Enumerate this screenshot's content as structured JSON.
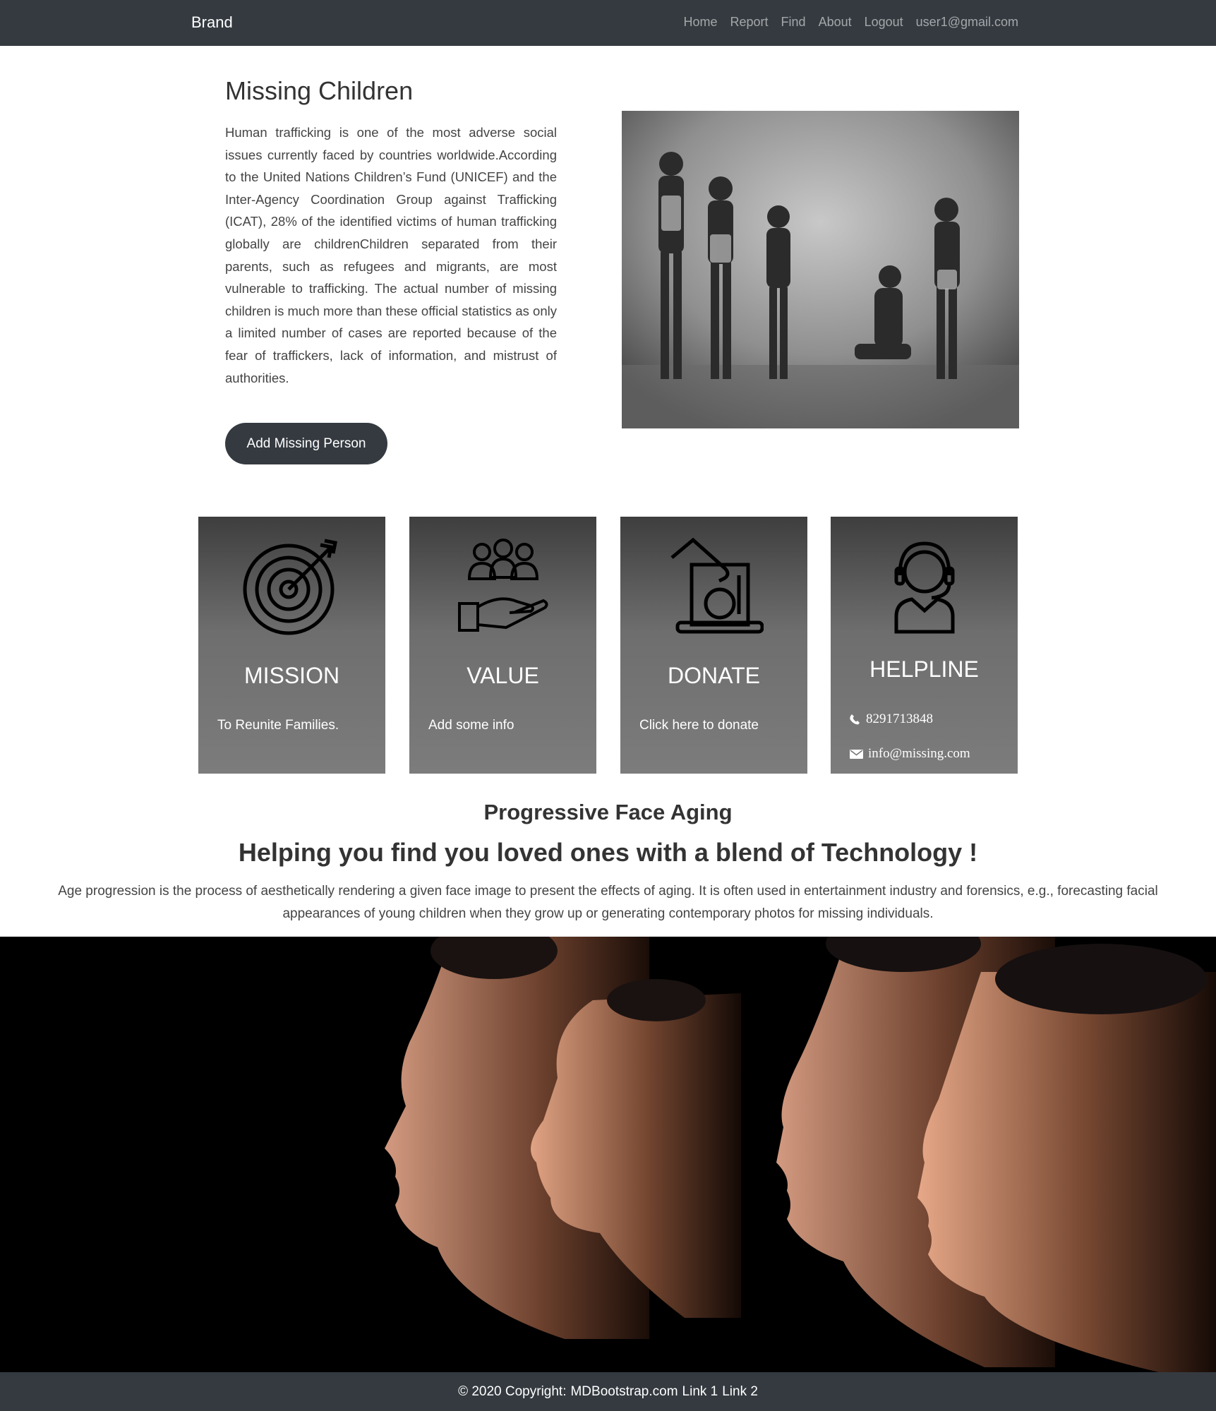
{
  "navbar": {
    "brand": "Brand",
    "links": [
      "Home",
      "Report",
      "Find",
      "About",
      "Logout",
      "user1@gmail.com"
    ]
  },
  "hero": {
    "title": "Missing Children",
    "text": "Human trafficking is one of the most adverse social issues currently faced by countries worldwide.According to the United Nations Children’s Fund (UNICEF) and the Inter-Agency Coordination Group against Trafficking (ICAT), 28% of the identified victims of human trafficking globally are childrenChildren separated from their parents, such as refugees and migrants, are most vulnerable to trafficking. The actual number of missing children is much more than these official statistics as only a limited number of cases are reported because of the fear of traffickers, lack of information, and mistrust of authorities.",
    "button": "Add Missing Person"
  },
  "cards": [
    {
      "title": "MISSION",
      "text": "To Reunite Families.",
      "icon": "target-icon"
    },
    {
      "title": "VALUE",
      "text": "Add some info",
      "icon": "people-hand-icon"
    },
    {
      "title": "DONATE",
      "text": "Click here to donate",
      "icon": "donation-box-icon"
    },
    {
      "title": "HELPLINE",
      "phone": "8291713848",
      "email": "info@missing.com",
      "icon": "headset-agent-icon"
    }
  ],
  "section": {
    "subtitle": "Progressive Face Aging",
    "title": "Helping you find you loved ones with a blend of Technology !",
    "text": "Age progression is the process of aesthetically rendering a given face image to present the effects of aging. It is often used in entertainment industry and forensics, e.g., forecasting facial appearances of young children when they grow up or generating contemporary photos for missing individuals."
  },
  "footer": {
    "copyright": "© 2020 Copyright:",
    "site": "MDBootstrap.com",
    "link1": "Link 1",
    "link2": "Link 2"
  }
}
